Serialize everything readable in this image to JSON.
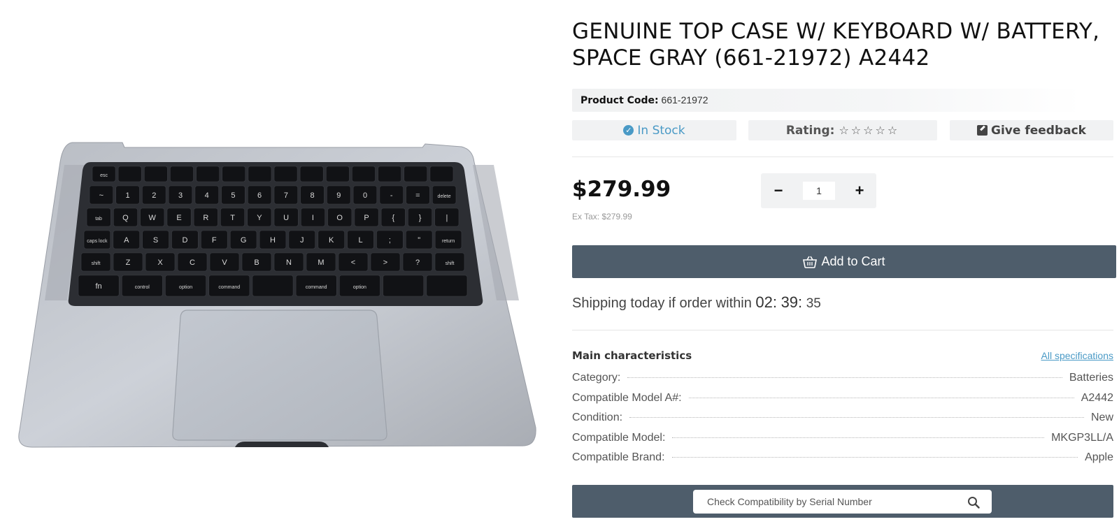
{
  "product": {
    "title": "GENUINE TOP CASE W/ KEYBOARD W/ BATTERY, SPACE GRAY (661-21972) A2442",
    "code_label": "Product Code:",
    "code_value": "661-21972"
  },
  "status": {
    "stock": "In Stock",
    "rating_label": "Rating:",
    "rating_stars": "☆☆☆☆☆",
    "rating_value": 0,
    "feedback": "Give feedback"
  },
  "pricing": {
    "price": "$279.99",
    "ex_tax": "Ex Tax: $279.99"
  },
  "quantity": {
    "minus": "−",
    "plus": "+",
    "value": "1"
  },
  "cart": {
    "label": "Add to Cart"
  },
  "shipping": {
    "text": "Shipping today if order within",
    "hours": "02",
    "minutes": "39",
    "seconds": "35"
  },
  "characteristics": {
    "title": "Main characteristics",
    "all_link": "All specifications",
    "rows": [
      {
        "key": "Category:",
        "value": "Batteries"
      },
      {
        "key": "Compatible Model A#:",
        "value": "A2442"
      },
      {
        "key": "Condition:",
        "value": "New"
      },
      {
        "key": "Compatible Model:",
        "value": "MKGP3LL/A"
      },
      {
        "key": "Compatible Brand:",
        "value": "Apple"
      }
    ]
  },
  "serial": {
    "placeholder": "Check Compatibility by Serial Number"
  },
  "keyboard_legends": {
    "row0": [
      "esc"
    ],
    "row1": [
      "~",
      "1",
      "2",
      "3",
      "4",
      "5",
      "6",
      "7",
      "8",
      "9",
      "0",
      "-",
      "=",
      "delete"
    ],
    "row2": [
      "tab",
      "Q",
      "W",
      "E",
      "R",
      "T",
      "Y",
      "U",
      "I",
      "O",
      "P",
      "{",
      "}",
      "|"
    ],
    "row3": [
      "caps lock",
      "A",
      "S",
      "D",
      "F",
      "G",
      "H",
      "J",
      "K",
      "L",
      ";",
      "\"",
      "return"
    ],
    "row4": [
      "shift",
      "Z",
      "X",
      "C",
      "V",
      "B",
      "N",
      "M",
      "<",
      ">",
      "?",
      "shift"
    ],
    "row5": [
      "fn",
      "control",
      "option",
      "command",
      "",
      "command",
      "option"
    ]
  },
  "icons": {
    "stock": "check-circle-icon",
    "feedback": "edit-icon",
    "cart": "basket-icon",
    "search": "search-icon"
  },
  "colors": {
    "accent_blue": "#4a9ac6",
    "button_dark": "#4e5d6b",
    "pill_bg": "#f1f2f3"
  }
}
